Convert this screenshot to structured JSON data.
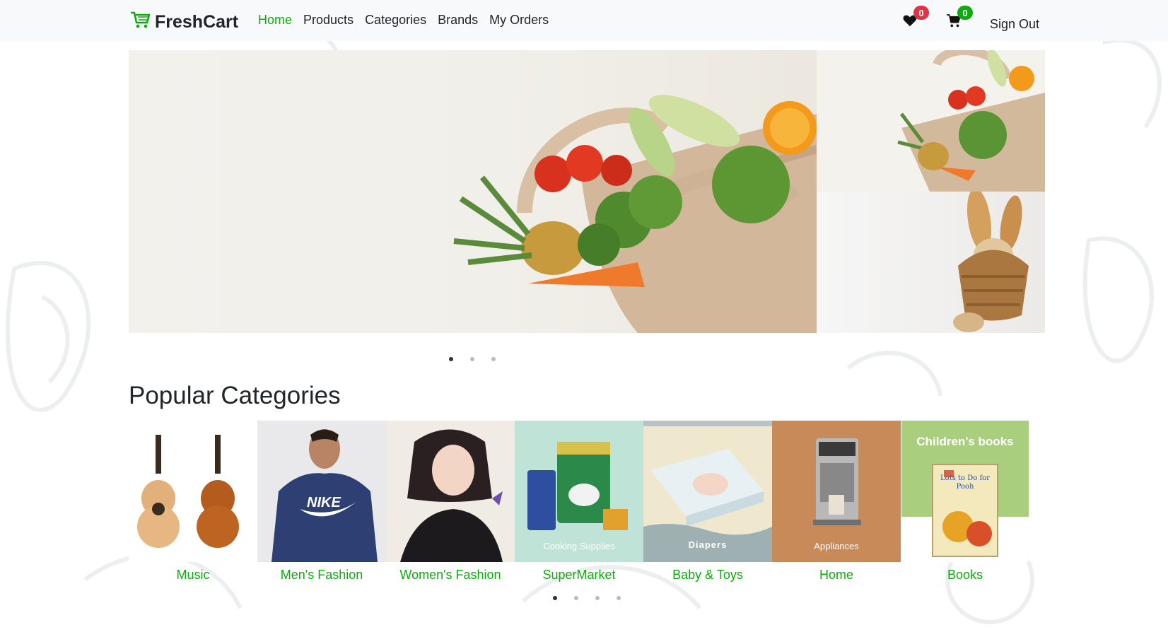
{
  "navbar": {
    "brand": "FreshCart",
    "links": [
      {
        "label": "Home",
        "active": true
      },
      {
        "label": "Products",
        "active": false
      },
      {
        "label": "Categories",
        "active": false
      },
      {
        "label": "Brands",
        "active": false
      },
      {
        "label": "My Orders",
        "active": false
      }
    ],
    "wishlist_count": "0",
    "cart_count": "0",
    "sign_out": "Sign Out"
  },
  "hero": {
    "main_alt": "grocery-bag-icon",
    "side_top_alt": "grocery-bag-icon",
    "side_bottom_alt": "bread-basket-icon",
    "dots_count": 3,
    "active_dot": 0
  },
  "popular": {
    "title": "Popular Categories",
    "categories": [
      {
        "label": "Music",
        "icon": "guitar-icon"
      },
      {
        "label": "Men's Fashion",
        "icon": "hoodie-icon"
      },
      {
        "label": "Women's Fashion",
        "icon": "woman-portrait-icon",
        "overlay": ""
      },
      {
        "label": "SuperMarket",
        "icon": "cooking-supplies-icon",
        "overlay": "Cooking Supplies"
      },
      {
        "label": "Baby & Toys",
        "icon": "diapers-icon",
        "overlay": "Diapers"
      },
      {
        "label": "Home",
        "icon": "coffee-machine-icon",
        "overlay": "Appliances"
      },
      {
        "label": "Books",
        "icon": "book-icon",
        "overlay": "Children's books",
        "book_title": "Lots to Do for Pooh"
      }
    ],
    "dots_count": 4,
    "active_dot": 0
  },
  "colors": {
    "accent": "#0aad0a",
    "wishlist_badge": "#dc3545",
    "cart_badge": "#198754"
  }
}
